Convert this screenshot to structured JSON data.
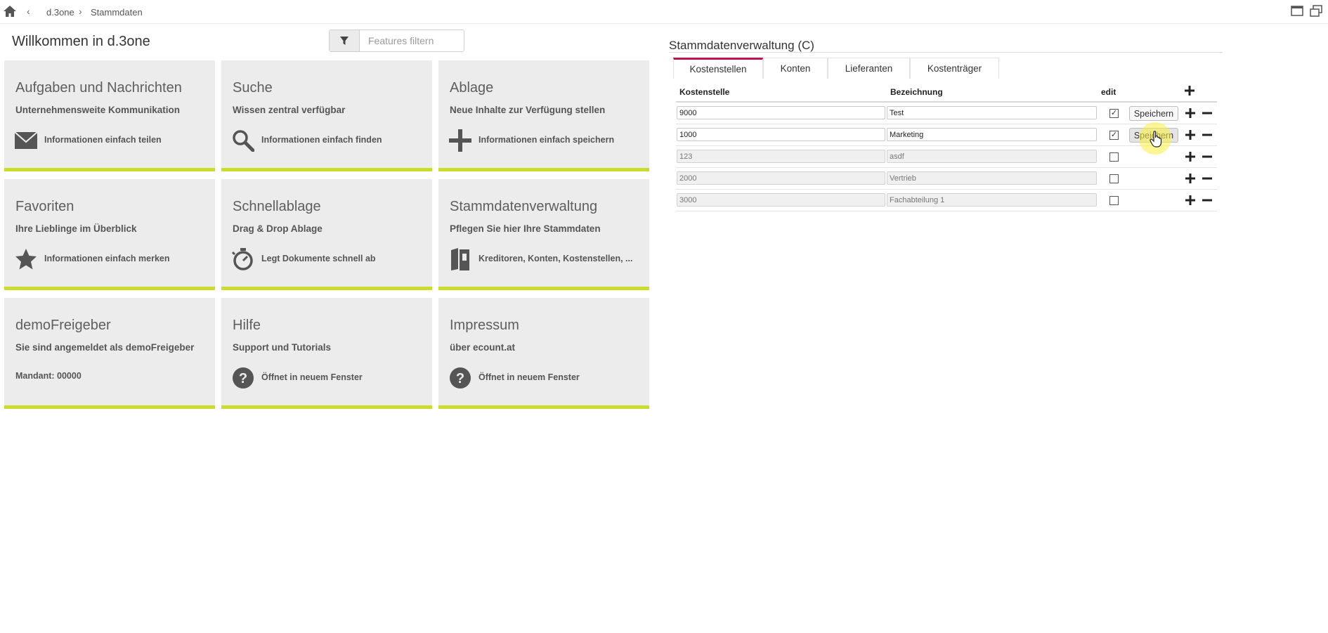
{
  "topbar": {
    "crumbs": [
      "d.3one",
      "Stammdaten"
    ]
  },
  "dashboard": {
    "welcome": "Willkommen in d.3one",
    "filter_placeholder": "Features filtern",
    "tiles": [
      {
        "title": "Aufgaben und Nachrichten",
        "subtitle": "Unternehmensweite Kommunikation",
        "text": "Informationen einfach teilen",
        "icon": "mail-icon"
      },
      {
        "title": "Suche",
        "subtitle": "Wissen zentral verfügbar",
        "text": "Informationen einfach finden",
        "icon": "search-icon"
      },
      {
        "title": "Ablage",
        "subtitle": "Neue Inhalte zur Verfügung stellen",
        "text": "Informationen einfach speichern",
        "icon": "plus-icon"
      },
      {
        "title": "Favoriten",
        "subtitle": "Ihre Lieblinge im Überblick",
        "text": "Informationen einfach merken",
        "icon": "star-icon"
      },
      {
        "title": "Schnellablage",
        "subtitle": "Drag & Drop Ablage",
        "text": "Legt Dokumente schnell ab",
        "icon": "stopwatch-icon"
      },
      {
        "title": "Stammdatenverwaltung",
        "subtitle": "Pflegen Sie hier Ihre Stammdaten",
        "text": "Kreditoren, Konten, Kostenstellen, ...",
        "icon": "book-icon"
      },
      {
        "title": "demoFreigeber",
        "subtitle": "Sie sind angemeldet als demoFreigeber",
        "text": "Mandant: 00000",
        "icon": ""
      },
      {
        "title": "Hilfe",
        "subtitle": "Support und Tutorials",
        "text": "Öffnet in neuem Fenster",
        "icon": "help-icon"
      },
      {
        "title": "Impressum",
        "subtitle": "über ecount.at",
        "text": "Öffnet in neuem Fenster",
        "icon": "help-icon"
      }
    ]
  },
  "stammdaten": {
    "title": "Stammdatenverwaltung (C)",
    "tabs": [
      "Kostenstellen",
      "Konten",
      "Lieferanten",
      "Kostenträger"
    ],
    "active_tab": "Kostenstellen",
    "columns": [
      "Kostenstelle",
      "Bezeichnung",
      "edit"
    ],
    "save_label": "Speichern",
    "rows": [
      {
        "kostenstelle": "9000",
        "bezeichnung": "Test",
        "edit": true
      },
      {
        "kostenstelle": "1000",
        "bezeichnung": "Marketing",
        "edit": true
      },
      {
        "kostenstelle": "123",
        "bezeichnung": "asdf",
        "edit": false
      },
      {
        "kostenstelle": "2000",
        "bezeichnung": "Vertrieb",
        "edit": false
      },
      {
        "kostenstelle": "3000",
        "bezeichnung": "Fachabteilung 1",
        "edit": false
      }
    ]
  },
  "colors": {
    "accent_tab": "#c2114b",
    "tile_bar": "#c9dd2a",
    "tile_bg": "#edecec"
  }
}
